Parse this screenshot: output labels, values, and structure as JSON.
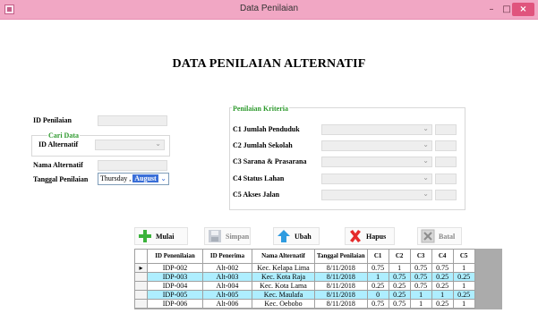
{
  "window": {
    "title": "Data Penilaian",
    "minimize_glyph": "–",
    "maximize_glyph": "□",
    "close_glyph": "×"
  },
  "page_title": "DATA PENILAIAN ALTERNATIF",
  "left_form": {
    "id_penilaian_label": "ID Penilaian",
    "id_penilaian_value": "",
    "cari_data_label": "Cari Data",
    "id_alternatif_label": "ID Alternatif",
    "id_alternatif_value": "",
    "nama_alternatif_label": "Nama Alternatif",
    "nama_alternatif_value": "",
    "tanggal_label": "Tanggal Penilaian",
    "tanggal_day": "Thursday ,",
    "tanggal_month": "August"
  },
  "criteria": {
    "group_label": "Penilaian Kriteria",
    "items": [
      {
        "label": "C1  Jumlah Penduduk",
        "value": "",
        "score": ""
      },
      {
        "label": "C2  Jumlah Sekolah",
        "value": "",
        "score": ""
      },
      {
        "label": "C3  Sarana & Prasarana",
        "value": "",
        "score": ""
      },
      {
        "label": "C4  Status Lahan",
        "value": "",
        "score": ""
      },
      {
        "label": "C5  Akses Jalan",
        "value": "",
        "score": ""
      }
    ]
  },
  "buttons": {
    "mulai": "Mulai",
    "simpan": "Simpan",
    "ubah": "Ubah",
    "hapus": "Hapus",
    "batal": "Batal"
  },
  "colors": {
    "titlebar": "#f1a7c4",
    "alt_row": "#aeeeff",
    "group_label_green": "#2e9a2e",
    "row_marker": "▸"
  },
  "grid": {
    "columns": [
      "ID Penenilaian",
      "ID Penerima",
      "Nama Alternatif",
      "Tanggal Penilaian",
      "C1",
      "C2",
      "C3",
      "C4",
      "C5"
    ],
    "rows": [
      [
        "IDP-002",
        "Alt-002",
        "Kec. Kelapa Lima",
        "8/11/2018",
        "0.75",
        "1",
        "0.75",
        "0.75",
        "1"
      ],
      [
        "IDP-003",
        "Alt-003",
        "Kec. Kota Raja",
        "8/11/2018",
        "1",
        "0.75",
        "0.75",
        "0.25",
        "0.25"
      ],
      [
        "IDP-004",
        "Alt-004",
        "Kec. Kota Lama",
        "8/11/2018",
        "0.25",
        "0.25",
        "0.75",
        "0.25",
        "1"
      ],
      [
        "IDP-005",
        "Alt-005",
        "Kec. Maulafa",
        "8/11/2018",
        "0",
        "0.25",
        "1",
        "1",
        "0.25"
      ],
      [
        "IDP-006",
        "Alt-006",
        "Kec. Oebobo",
        "8/11/2018",
        "0.75",
        "0.75",
        "1",
        "0.25",
        "1"
      ]
    ]
  }
}
